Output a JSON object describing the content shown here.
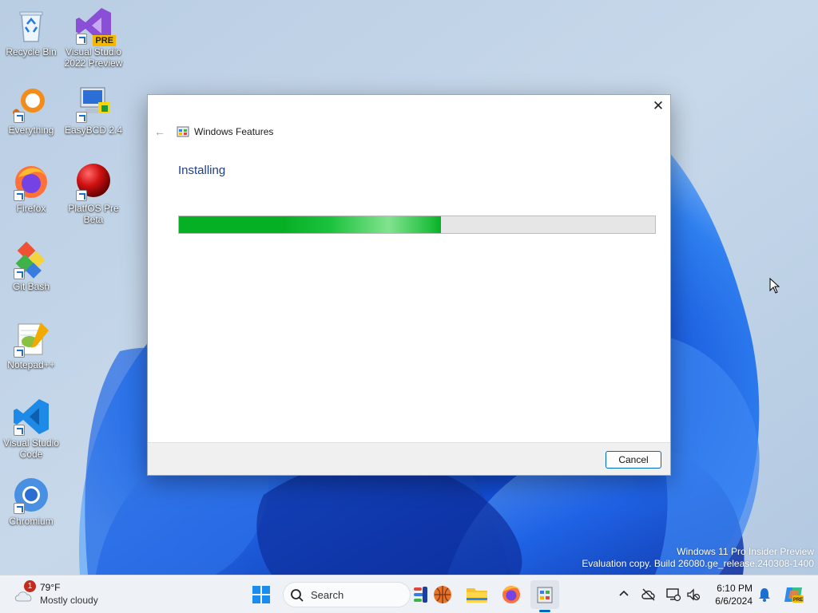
{
  "desktop": {
    "icons": [
      {
        "label": "Recycle Bin",
        "icon": "recycle-bin-icon"
      },
      {
        "label": "Visual Studio 2022 Preview",
        "icon": "visual-studio-icon",
        "badge": "PRE"
      },
      {
        "label": "Everything",
        "icon": "everything-icon"
      },
      {
        "label": "EasyBCD 2.4",
        "icon": "easybcd-icon"
      },
      {
        "label": "Firefox",
        "icon": "firefox-icon"
      },
      {
        "label": "PlatfOS Pre Beta",
        "icon": "platfos-icon"
      },
      {
        "label": "Git Bash",
        "icon": "git-bash-icon"
      },
      {
        "label": "Notepad++",
        "icon": "notepad-plus-plus-icon"
      },
      {
        "label": "Visual Studio Code",
        "icon": "vscode-icon"
      },
      {
        "label": "Chromium",
        "icon": "chromium-icon"
      }
    ]
  },
  "dialog": {
    "title": "Windows Features",
    "close_glyph": "✕",
    "back_glyph": "←",
    "status": "Installing",
    "progress_fraction": 0.55,
    "cancel_label": "Cancel"
  },
  "watermark": {
    "line1": "Windows 11 Pro Insider Preview",
    "line2": "Evaluation copy. Build 26080.ge_release.240308-1400"
  },
  "taskbar": {
    "weather": {
      "badge": "1",
      "temp": "79°F",
      "desc": "Mostly cloudy"
    },
    "search_label": "Search",
    "clock": {
      "time": "6:10 PM",
      "date": "6/6/2024"
    }
  },
  "colors": {
    "accent": "#0067c0",
    "progress_green": "#06b025",
    "heading_blue": "#1c3f86"
  }
}
